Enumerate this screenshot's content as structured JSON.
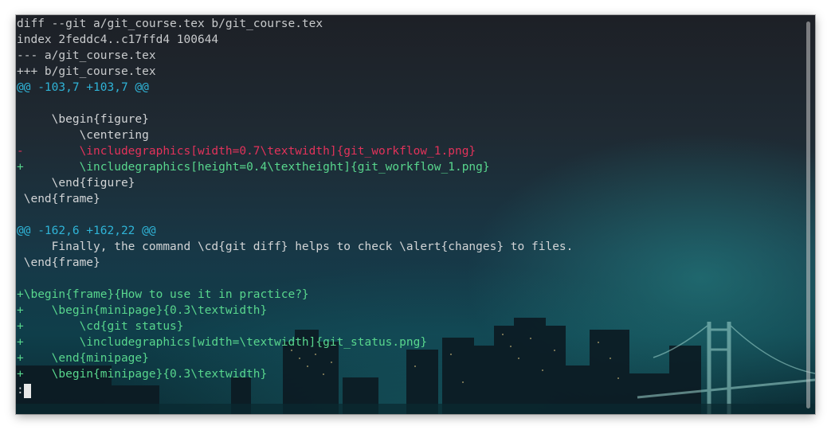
{
  "terminal": {
    "lines": [
      {
        "text": "diff --git a/git_course.tex b/git_course.tex",
        "kind": "header"
      },
      {
        "text": "index 2feddc4..c17ffd4 100644",
        "kind": "header"
      },
      {
        "text": "--- a/git_course.tex",
        "kind": "header"
      },
      {
        "text": "+++ b/git_course.tex",
        "kind": "header"
      },
      {
        "text": "@@ -103,7 +103,7 @@",
        "kind": "hunk"
      },
      {
        "text": "",
        "kind": "ctx"
      },
      {
        "text": "     \\begin{figure}",
        "kind": "ctx"
      },
      {
        "text": "         \\centering",
        "kind": "ctx"
      },
      {
        "text": "-        \\includegraphics[width=0.7\\textwidth]{git_workflow_1.png}",
        "kind": "del"
      },
      {
        "text": "+        \\includegraphics[height=0.4\\textheight]{git_workflow_1.png}",
        "kind": "add"
      },
      {
        "text": "     \\end{figure}",
        "kind": "ctx"
      },
      {
        "text": " \\end{frame}",
        "kind": "ctx"
      },
      {
        "text": "",
        "kind": "ctx"
      },
      {
        "text": "@@ -162,6 +162,22 @@",
        "kind": "hunk"
      },
      {
        "text": "     Finally, the command \\cd{git diff} helps to check \\alert{changes} to files.",
        "kind": "ctx"
      },
      {
        "text": " \\end{frame}",
        "kind": "ctx"
      },
      {
        "text": "",
        "kind": "ctx"
      },
      {
        "text": "+\\begin{frame}{How to use it in practice?}",
        "kind": "add"
      },
      {
        "text": "+    \\begin{minipage}{0.3\\textwidth}",
        "kind": "add"
      },
      {
        "text": "+        \\cd{git status}",
        "kind": "add"
      },
      {
        "text": "+        \\includegraphics[width=\\textwidth]{git_status.png}",
        "kind": "add"
      },
      {
        "text": "+    \\end{minipage}",
        "kind": "add"
      },
      {
        "text": "+    \\begin{minipage}{0.3\\textwidth}",
        "kind": "add"
      },
      {
        "text": ":",
        "kind": "ctx"
      }
    ]
  },
  "colors": {
    "header": "#c8cacc",
    "hunk": "#2fb3d6",
    "context": "#d2d4d6",
    "deleted": "#e2325a",
    "added": "#58d68d"
  }
}
